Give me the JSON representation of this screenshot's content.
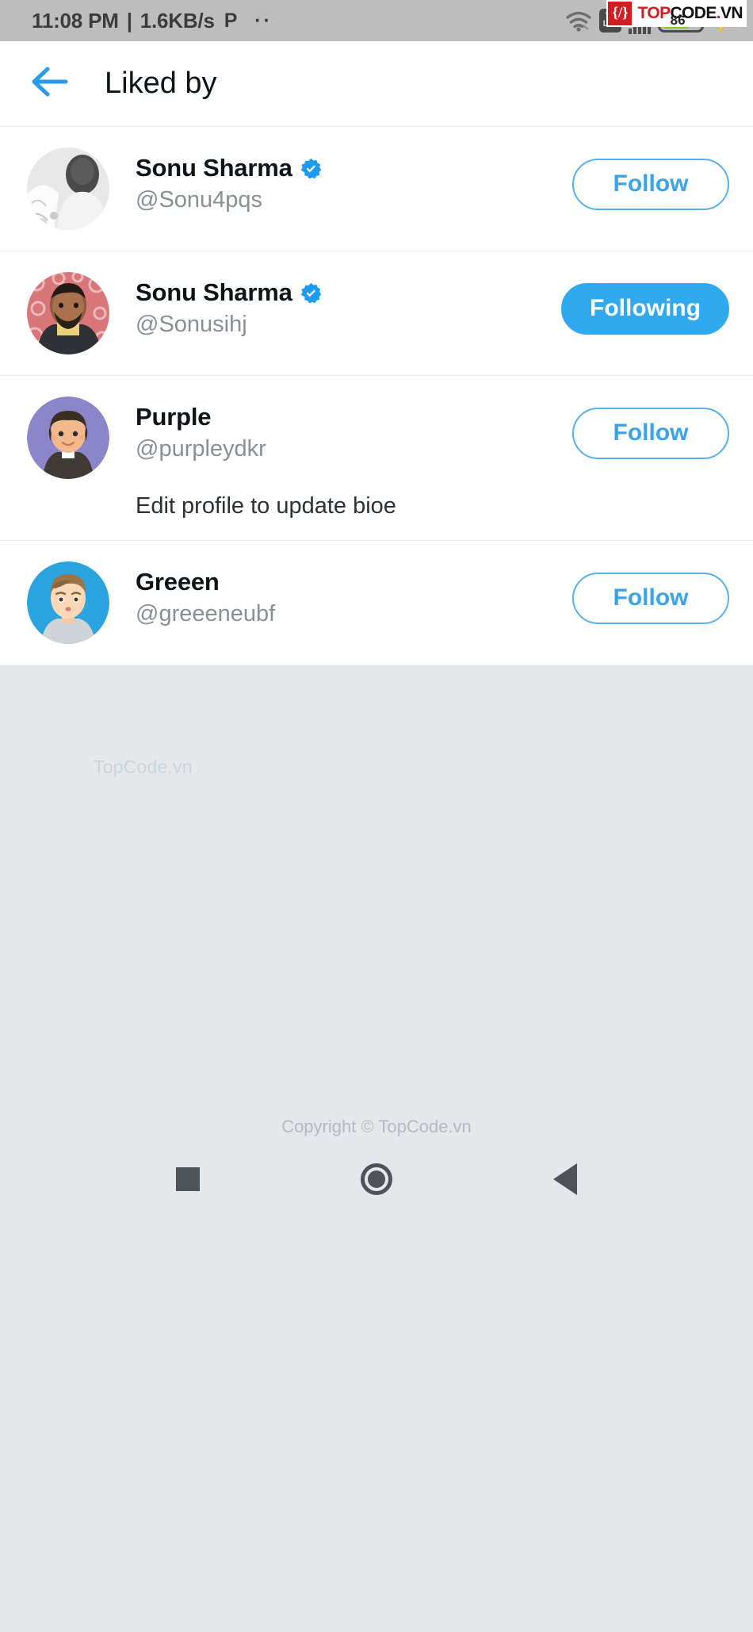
{
  "status_bar": {
    "time": "11:08 PM",
    "separator": "|",
    "network_speed": "1.6KB/s",
    "pinterest_glyph": "P",
    "notification_dots": "··",
    "wifi_icon": "wifi-icon",
    "volte_top": "Vo",
    "volte_bottom": "LTE",
    "network_generation": "4G",
    "signal_icon": "signal-bars-icon",
    "battery_level": "86",
    "charging_icon": "lightning-bolt-icon",
    "battery_color": "#7ed321"
  },
  "watermark_logo": {
    "badge": "{/}",
    "top": "TOP",
    "code": "CODE",
    "dot": ".",
    "vn": "VN",
    "brand_red": "#cf1f22"
  },
  "app_bar": {
    "back_icon": "back-arrow-icon",
    "title": "Liked by",
    "accent": "#2a9bea"
  },
  "users": [
    {
      "name": "Sonu Sharma",
      "handle": "@Sonu4pqs",
      "verified": true,
      "bio": "",
      "button_label": "Follow",
      "button_state": "follow",
      "avatar": "photo-bw-man-avatar"
    },
    {
      "name": "Sonu Sharma",
      "handle": "@Sonusihj",
      "verified": true,
      "bio": "",
      "button_label": "Following",
      "button_state": "following",
      "avatar": "photo-man-red-background-avatar"
    },
    {
      "name": "Purple",
      "handle": "@purpleydkr",
      "verified": false,
      "bio": "Edit profile to update bioe",
      "button_label": "Follow",
      "button_state": "follow",
      "avatar": "illustration-purple-avatar"
    },
    {
      "name": "Greeen",
      "handle": "@greeeneubf",
      "verified": false,
      "bio": "",
      "button_label": "Follow",
      "button_state": "follow",
      "avatar": "illustration-blue-avatar"
    }
  ],
  "empty_area": {
    "watermark": "TopCode.vn",
    "copyright": "Copyright © TopCode.vn",
    "background": "#e4e8eb"
  },
  "nav_bar": {
    "recents_icon": "square-recents-icon",
    "home_icon": "circle-home-icon",
    "back_icon": "triangle-back-icon"
  }
}
